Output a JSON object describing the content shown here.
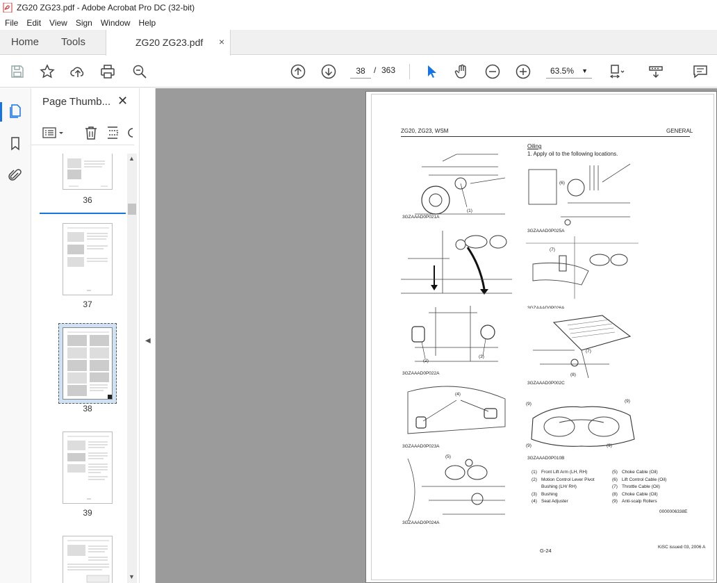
{
  "window": {
    "title": "ZG20 ZG23.pdf - Adobe Acrobat Pro DC (32-bit)"
  },
  "menu": [
    "File",
    "Edit",
    "View",
    "Sign",
    "Window",
    "Help"
  ],
  "tabs": {
    "home": "Home",
    "tools": "Tools",
    "document": "ZG20 ZG23.pdf",
    "close": "×"
  },
  "toolbar": {
    "current_page": "38",
    "separator": "/",
    "total_pages": "363",
    "zoom": "63.5%"
  },
  "thumbnails": {
    "title": "Page Thumb...",
    "pages": [
      {
        "label": "36"
      },
      {
        "label": "37"
      },
      {
        "label": "38"
      },
      {
        "label": "39"
      }
    ],
    "selected_page": "38"
  },
  "page": {
    "header_left": "ZG20, ZG23, WSM",
    "header_right": "GENERAL",
    "section": "Oiling",
    "step": "1.  Apply oil to the following locations.",
    "figures": [
      "3GZAAAD0P021A",
      "3GZAAAD0P025A",
      "3GZAAAD0P026A",
      "3GZAAAD0P022A",
      "3GZAAAD0P002C",
      "3GZAAAD0P023A",
      "3GZAAAD0P010B",
      "3GZAAAD0P024A"
    ],
    "callouts": [
      "(1)",
      "(6)",
      "(7)",
      "(2)",
      "(3)",
      "(7)",
      "(8)",
      "(4)",
      "(9)",
      "(9)",
      "(9)",
      "(9)",
      "(5)"
    ],
    "legend_left": [
      {
        "num": "(1)",
        "text": "Front Lift Arm (LH, RH)"
      },
      {
        "num": "(2)",
        "text": "Motion Control Lever Pivot"
      },
      {
        "num": "",
        "text": "Bushing (LH/ RH)"
      },
      {
        "num": "(3)",
        "text": "Bushing"
      },
      {
        "num": "(4)",
        "text": "Seat Adjuster"
      }
    ],
    "legend_right": [
      {
        "num": "(5)",
        "text": "Choke Cable (Oil)"
      },
      {
        "num": "(6)",
        "text": "Lift Control Cable (Oil)"
      },
      {
        "num": "(7)",
        "text": "Throttle Cable (Oil)"
      },
      {
        "num": "(8)",
        "text": "Choke Cable (Oil)"
      },
      {
        "num": "(9)",
        "text": "Anti-scalp Rollers"
      }
    ],
    "doc_code": "0000006338E",
    "issued": "KiSC issued 03, 2006 A",
    "page_number": "G-24"
  }
}
